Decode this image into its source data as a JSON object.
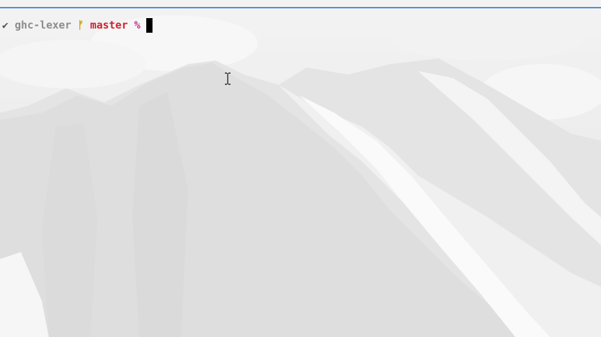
{
  "prompt": {
    "status_glyph": "✔",
    "directory": "ghc-lexer",
    "branch_glyph": "ᚠ",
    "branch": "master",
    "symbol": "%"
  },
  "colors": {
    "accent_border": "#4a8fd6",
    "status": "#555555",
    "directory": "#8c8c8c",
    "branch_icon": "#c8a000",
    "branch": "#d11f2f",
    "symbol": "#c8308c",
    "cursor": "#000000"
  },
  "icons": {
    "status": "check-icon",
    "branch": "git-branch-icon",
    "pointer": "text-ibeam-cursor-icon"
  }
}
